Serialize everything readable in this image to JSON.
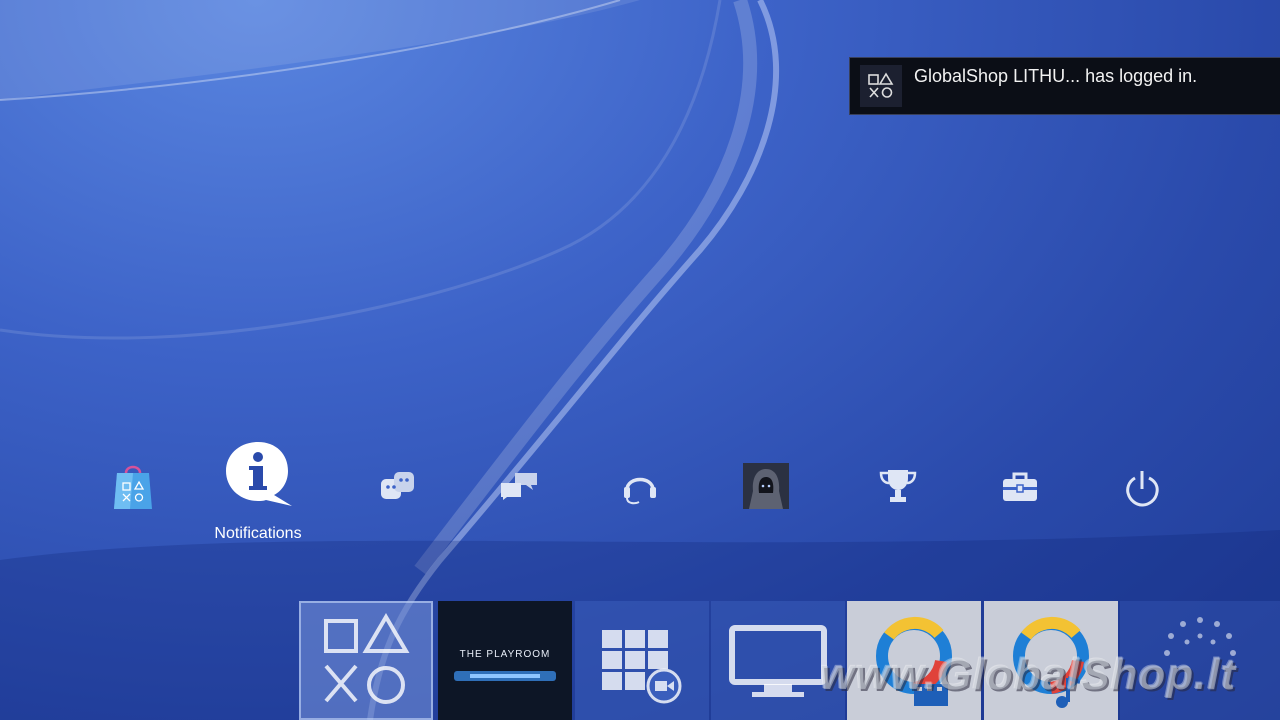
{
  "notification": {
    "message": "GlobalShop LITHU... has logged in."
  },
  "function_row": {
    "items": [
      {
        "name": "PlayStation Store",
        "icon": "store-bag-icon"
      },
      {
        "name": "Notifications",
        "icon": "info-bubble-icon",
        "label": "Notifications",
        "selected": true
      },
      {
        "name": "Friends",
        "icon": "friends-icon"
      },
      {
        "name": "Messages",
        "icon": "messages-icon"
      },
      {
        "name": "Party",
        "icon": "headset-icon"
      },
      {
        "name": "Profile",
        "icon": "avatar-icon"
      },
      {
        "name": "Trophies",
        "icon": "trophy-icon"
      },
      {
        "name": "Settings",
        "icon": "toolbox-icon"
      },
      {
        "name": "Power",
        "icon": "power-icon"
      }
    ]
  },
  "content_row": {
    "playroom_title": "THE PLAYROOM",
    "tiles": [
      "ps-symbols-icon",
      "playroom",
      "tv-video-icon",
      "monitor-icon",
      "video-unlimited-icon",
      "music-unlimited-icon",
      "internet-browser-icon"
    ]
  },
  "watermark": "www.GlobalShop.lt",
  "colors": {
    "background": "#2f50b4",
    "toast": "#0b0e16",
    "accent": "#ffffff"
  }
}
